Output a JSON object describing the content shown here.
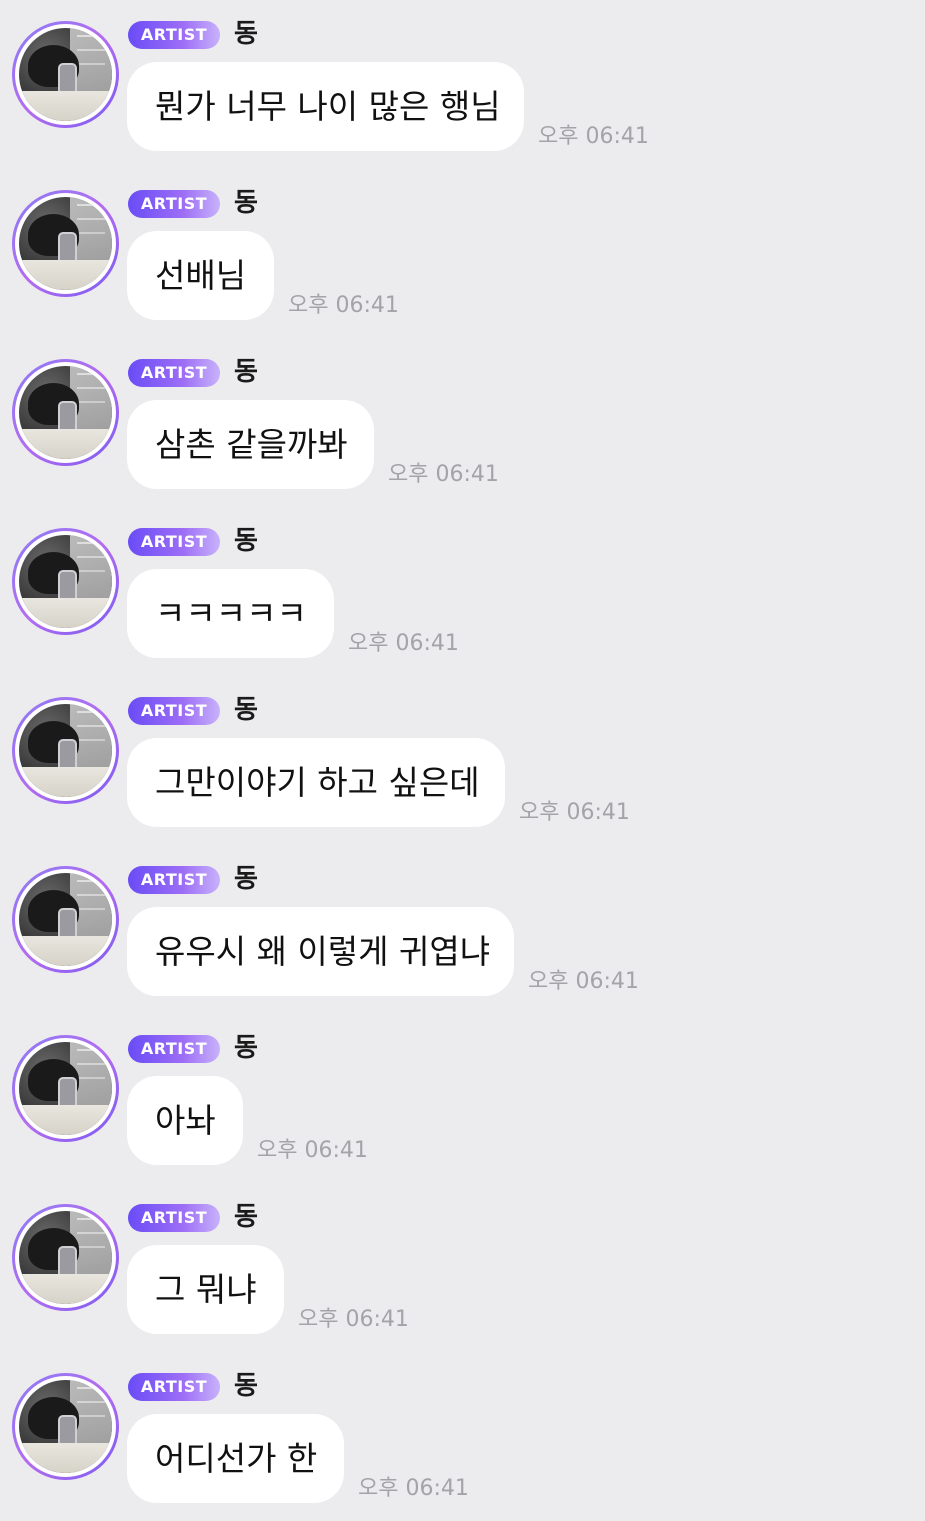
{
  "chat": {
    "background_color": "#ececef",
    "badge_colors": [
      "#6a4cf6",
      "#9d6ef6",
      "#c8b2fa"
    ],
    "messages": [
      {
        "badge": "ARTIST",
        "sender": "동",
        "avatar": "profile-photo-icon",
        "text": "뭔가 너무 나이 많은 행님",
        "time": "오후 06:41"
      },
      {
        "badge": "ARTIST",
        "sender": "동",
        "avatar": "profile-photo-icon",
        "text": "선배님",
        "time": "오후 06:41"
      },
      {
        "badge": "ARTIST",
        "sender": "동",
        "avatar": "profile-photo-icon",
        "text": "삼촌 같을까봐",
        "time": "오후 06:41"
      },
      {
        "badge": "ARTIST",
        "sender": "동",
        "avatar": "profile-photo-icon",
        "text": "ㅋㅋㅋㅋㅋ",
        "time": "오후 06:41"
      },
      {
        "badge": "ARTIST",
        "sender": "동",
        "avatar": "profile-photo-icon",
        "text": "그만이야기 하고 싶은데",
        "time": "오후 06:41"
      },
      {
        "badge": "ARTIST",
        "sender": "동",
        "avatar": "profile-photo-icon",
        "text": "유우시 왜 이렇게 귀엽냐",
        "time": "오후 06:41"
      },
      {
        "badge": "ARTIST",
        "sender": "동",
        "avatar": "profile-photo-icon",
        "text": "아놔",
        "time": "오후 06:41"
      },
      {
        "badge": "ARTIST",
        "sender": "동",
        "avatar": "profile-photo-icon",
        "text": "그 뭐냐",
        "time": "오후 06:41"
      },
      {
        "badge": "ARTIST",
        "sender": "동",
        "avatar": "profile-photo-icon",
        "text": "어디선가 한",
        "time": "오후 06:41"
      }
    ]
  }
}
